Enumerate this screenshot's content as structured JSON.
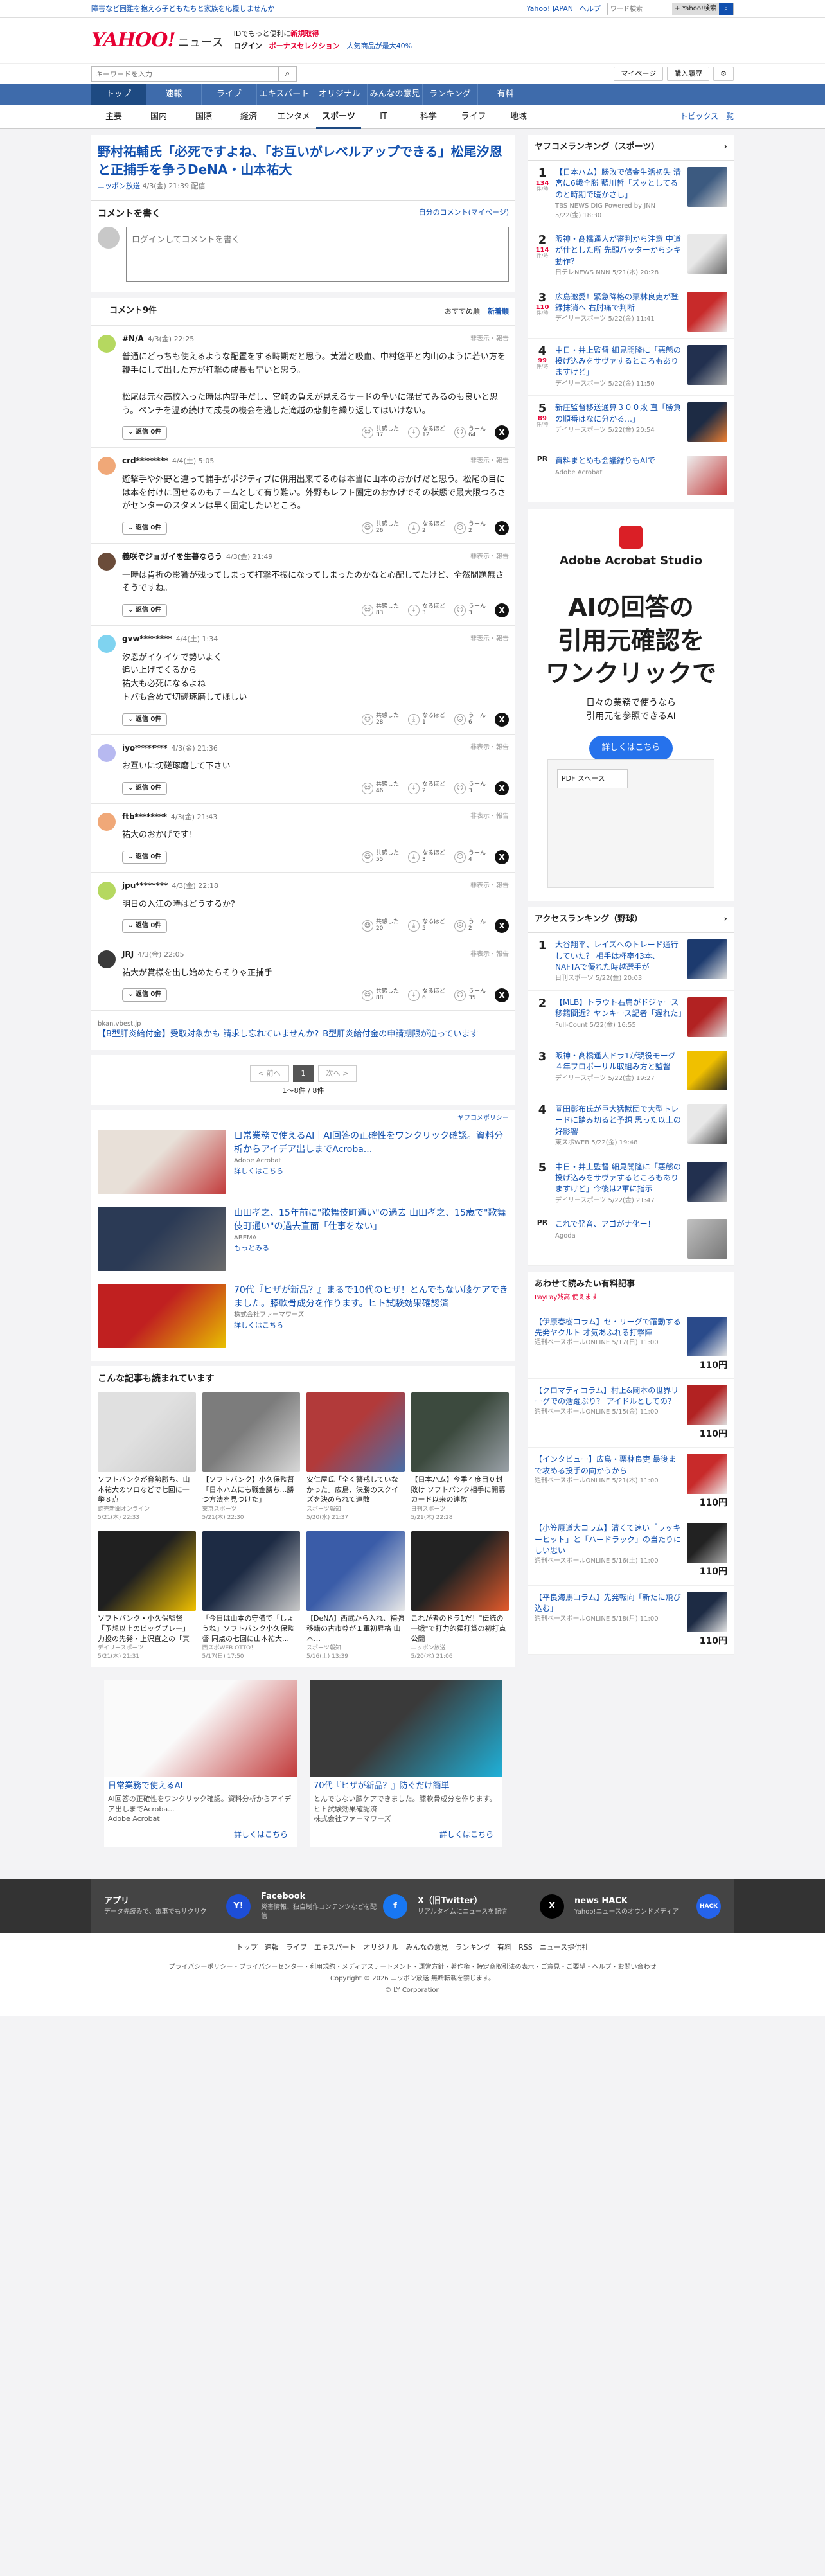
{
  "topbar": {
    "promo": "障害など困難を抱える子どもたちと家族を応援しませんか",
    "yahoo_japan": "Yahoo! JAPAN",
    "help": "ヘルプ",
    "search_placeholder": "ワード検索",
    "search_btn": "+ Yahoo!検索"
  },
  "header": {
    "logo_main": "YAHOO!",
    "logo_sub": "JAPAN",
    "logo_news": "ニュース",
    "line1": "IDでもっと便利に",
    "line1_red": "新規取得",
    "login": "ログイン",
    "bonus": "ボーナスセレクション",
    "bonus_tail": "人気商品が最大40%"
  },
  "bar2": {
    "keyword_placeholder": "キーワードを入力",
    "mypage": "マイページ",
    "history": "購入履歴"
  },
  "nav": [
    "トップ",
    "速報",
    "ライブ",
    "エキスパート",
    "オリジナル",
    "みんなの意見",
    "ランキング",
    "有料"
  ],
  "subnav": [
    "主要",
    "国内",
    "国際",
    "経済",
    "エンタメ",
    "スポーツ",
    "IT",
    "科学",
    "ライフ",
    "地域"
  ],
  "subnav_active": "スポーツ",
  "subnav_right": "トピックス一覧",
  "article": {
    "title": "野村祐輔氏「必死ですよね、「お互いがレベルアップできる」松尾汐恩と正捕手を争うDeNA・山本祐大",
    "source": "ニッポン放送",
    "date": "4/3(金) 21:39 配信"
  },
  "write": {
    "heading": "コメントを書く",
    "own": "自分のコメント(マイページ)",
    "placeholder": "ログインしてコメントを書く"
  },
  "comments_header": {
    "title": "コメント9件",
    "sort1": "おすすめ順",
    "sort2": "新着順"
  },
  "comments": [
    {
      "user": "#N/A",
      "date": "4/3(金) 22:25",
      "report": "非表示・報告",
      "text": "普通にどっちも使えるような配置をする時期だと思う。黄潜と吸血、中村悠平と内山のように若い方を鞭手にして出した方が打撃の成長も早いと思う。\n\n松尾は元々高校入った時は内野手だし、宮崎の負えが見えるサードの争いに混ぜてみるのも良いと思う。ベンチを温め続けて成長の機会を逃した滝越の悲劇を繰り返してはいけない。",
      "agree": "37",
      "understand": "12",
      "hmm": "64",
      "av": "#b5d860"
    },
    {
      "user": "crd********",
      "date": "4/4(土) 5:05",
      "report": "非表示・報告",
      "text": "遊撃手や外野と違って捕手がポジティブに併用出来てるのは本当に山本のおかげだと思う。松尾の目には本を付けに回せるのもチームとして有り難い。外野もレフト固定のおかげでその状態で最大限つろさがセンターのスタメンは早く固定したいところ。",
      "agree": "26",
      "understand": "2",
      "hmm": "2",
      "av": "#f0a878"
    },
    {
      "user": "義咲ぞジョガイを生暮ならう",
      "date": "4/3(金) 21:49",
      "report": "非表示・報告",
      "text": "一時は肯折の影響が残ってしまって打撃不振になってしまったのかなと心配してたけど、全然問題無さそうですね。",
      "agree": "83",
      "understand": "3",
      "hmm": "3",
      "av": "#6b4c3a"
    },
    {
      "user": "gvw********",
      "date": "4/4(土) 1:34",
      "report": "非表示・報告",
      "text": "汐恩がイケイケで勢いよく\n追い上げてくるから\n祐大も必死になるよね\nトバも含めて切磋琢磨してほしい",
      "agree": "28",
      "understand": "1",
      "hmm": "6",
      "av": "#7fd3f0"
    },
    {
      "user": "iyo********",
      "date": "4/3(金) 21:36",
      "report": "非表示・報告",
      "text": "お互いに切磋琢磨して下さい",
      "agree": "46",
      "understand": "2",
      "hmm": "3",
      "av": "#b7b9f0"
    },
    {
      "user": "ftb********",
      "date": "4/3(金) 21:43",
      "report": "非表示・報告",
      "text": "祐大のおかげです！",
      "agree": "55",
      "understand": "3",
      "hmm": "4",
      "av": "#f0a878"
    },
    {
      "user": "jpu********",
      "date": "4/3(金) 22:18",
      "report": "非表示・報告",
      "text": "明日の入江の時はどうするか？",
      "agree": "20",
      "understand": "5",
      "hmm": "2",
      "av": "#b5d860"
    },
    {
      "user": "JRJ",
      "date": "4/3(金) 22:05",
      "report": "非表示・報告",
      "text": "祐大が賞様を出し始めたらそりゃ正捕手",
      "agree": "88",
      "understand": "6",
      "hmm": "35",
      "av": "#3a3a3a"
    }
  ],
  "reply_label": "返信",
  "reply_count": "0件",
  "react_labels": {
    "agree": "共感した",
    "understand": "なるほど",
    "hmm": "うーん"
  },
  "inline_ad": {
    "domain": "bkan.vbest.jp",
    "title": "【B型肝炎給付金】受取対象かも 請求し忘れていませんか？B型肝炎給付金の申請期限が迫っています"
  },
  "pager": {
    "prev": "< 前へ",
    "current": "1",
    "next": "次へ >",
    "count": "1〜8件 / 8件"
  },
  "policy": "ヤフコメポリシー",
  "ads3": [
    {
      "title": "日常業務で使えるAI｜AI回答の正確性をワンクリック確認。資料分析からアイデア出しまでAcroba...",
      "sponsor": "Adobe Acrobat",
      "more": "詳しくはこちら",
      "c1": "#e8e0d8",
      "c2": "#c23b3b"
    },
    {
      "title": "山田孝之、15年前に\"歌舞伎町通い\"の過去 山田孝之、15歳で\"歌舞伎町通い\"の過去直面「仕事をない」",
      "sponsor": "ABEMA",
      "more": "もっとみる",
      "c1": "#2b3a55",
      "c2": "#6b6b6b"
    },
    {
      "title": "70代『ヒザが新品？』まるで10代のヒザ！とんでもない膝ケアできました。膝軟骨成分を作ります。ヒト試験効果確認済",
      "sponsor": "株式会社ファーマワーズ",
      "more": "詳しくはこちら",
      "c1": "#c02020",
      "c2": "#e8c000"
    }
  ],
  "recs_title": "こんな記事も読まれています",
  "recs": [
    {
      "t": "ソフトバンクが育勢勝ち、山本祐大のソロなどで七回に一挙８点",
      "s": "読売新聞オンライン",
      "d": "5/21(木) 22:33",
      "c1": "#e0e0e0",
      "c2": "#c8c8c8"
    },
    {
      "t": "【ソフトバンク】小久保監督「日本ハムにも戦金勝ち…勝つ方法を見つけた」",
      "s": "東京スポーツ",
      "d": "5/21(木) 22:30",
      "c1": "#7c7c7c",
      "c2": "#d8d8d8"
    },
    {
      "t": "安仁屋氏「全く警戒していなかった」広島、決勝のスクイズを決められて連敗",
      "s": "スポーツ報知",
      "d": "5/20(水) 21:37",
      "c1": "#b23a3a",
      "c2": "#4a6fa8"
    },
    {
      "t": "【日本ハム】今季４度目０封敗け ソフトバンク相手に開幕カード以来の連敗",
      "s": "日刊スポーツ",
      "d": "5/21(木) 22:28",
      "c1": "#3c4a3e",
      "c2": "#9aa1a8"
    },
    {
      "t": "ソフトバンク・小久保監督「予想以上のビッグプレー」力投の先発・上沢直之の「真価」と「隠れ苦労人」語る",
      "s": "デイリースポーツ",
      "d": "5/21(木) 21:31",
      "c1": "#202020",
      "c2": "#f0c000"
    },
    {
      "t": "「今日は山本の守備で「しょうね」ソフトバンク小久保監督 同点の七回に山本祐大…",
      "s": "西スポWEB OTTO！",
      "d": "5/17(日) 17:50",
      "c1": "#1d2b44",
      "c2": "#c9c9c9"
    },
    {
      "t": "【DeNA】西武から入れ、補強移籍の古市尊が１軍初昇格 山本…",
      "s": "スポーツ報知",
      "d": "5/16(土) 13:39",
      "c1": "#3a5ca8",
      "c2": "#e8e8e8"
    },
    {
      "t": "これが者のドラ1だ！\"伝統の一戦\"で打力的猛打賞の初打点 公開",
      "s": "ニッポン放送",
      "d": "5/20(水) 21:06",
      "c1": "#222",
      "c2": "#e25a2b"
    }
  ],
  "ads2": [
    {
      "title": "日常業務で使えるAI",
      "text": "AI回答の正確性をワンクリック確認。資料分析からアイデア出しまでAcroba...",
      "sponsor": "Adobe Acrobat",
      "more": "詳しくはこちら",
      "c1": "#fafafa",
      "c2": "#c23b3b"
    },
    {
      "title": "70代『ヒザが新品？』防ぐだけ簡単",
      "text": "とんでもない膝ケアできました。膝軟骨成分を作ります。ヒト試験効果確認済",
      "sponsor": "株式会社ファーマワーズ",
      "more": "詳しくはこちら",
      "c1": "#3a3a3a",
      "c2": "#1fb0d8"
    }
  ],
  "side_rank": {
    "title": "ヤフコメランキング（スポーツ）",
    "items": [
      {
        "no": "1",
        "cnt": "134",
        "lb": "件/時",
        "t": "【日本ハム】勝敗で償金生活初失 清宮に6戦全勝 藍川哲「ズッとしてるのと時期で暖かさし」",
        "s": "TBS NEWS DIG Powered by JNN",
        "d": "5/22(金) 18:30",
        "c1": "#3c5a80",
        "c2": "#d0d0d0"
      },
      {
        "no": "2",
        "cnt": "114",
        "lb": "件/時",
        "t": "阪神・髙橋遥人が審判から注意 中道が仕とした所 先頭バッターからシキ動作？",
        "s": "日テレNEWS NNN",
        "d": "5/21(木) 20:28",
        "c1": "#e8e8e8",
        "c2": "#666"
      },
      {
        "no": "3",
        "cnt": "110",
        "lb": "件/時",
        "t": "広島邀愛！緊急降格の栗林良吏が登録抹消へ 右肘痛で判断",
        "s": "デイリースポーツ",
        "d": "5/22(金) 11:41",
        "c1": "#c82a2a",
        "c2": "#e8e8e8"
      },
      {
        "no": "4",
        "cnt": "99",
        "lb": "件/時",
        "t": "中日・井上監督 細見開隆に「悪態の投げ込みをサヴァするところもありますけど」",
        "s": "デイリースポーツ",
        "d": "5/22(金) 11:50",
        "c1": "#22304f",
        "c2": "#aaa"
      },
      {
        "no": "5",
        "cnt": "89",
        "lb": "件/時",
        "t": "新庄監督移送通算３００敗 直「勝負の順番はなに分かる…」",
        "s": "デイリースポーツ",
        "d": "5/22(金) 20:54",
        "c1": "#1d2b44",
        "c2": "#f08030"
      }
    ],
    "pr_title": "資料まとめも会議録りもAIで",
    "pr_src": "Adobe Acrobat"
  },
  "bigad": {
    "brand": "Adobe Acrobat Studio",
    "h1": "AIの回答の\n引用元確認を\nワンクリックで",
    "sub": "日々の業務で使うなら\n引用元を参照できるAI",
    "btn": "詳しくはこちら",
    "pdf": "PDF スペース"
  },
  "access": {
    "title": "アクセスランキング（野球）",
    "items": [
      {
        "no": "1",
        "t": "大谷翔平、レイズへのトレード通行していた？ 相手は杯率43本、NAFTAで優れた時越選手が",
        "s": "日刊スポーツ",
        "d": "5/22(金) 20:03",
        "c1": "#1c3a6e",
        "c2": "#e0e0e0"
      },
      {
        "no": "2",
        "t": "【MLB】トラウト右肩がドジャース移籍間近？ヤンキース記者「遅れた」",
        "s": "Full-Count",
        "d": "5/22(金) 16:55",
        "c1": "#b22222",
        "c2": "#ddd"
      },
      {
        "no": "3",
        "t": "阪神・髙橋遥人ドラ1が現役モーグ ４年プロポーサル取組み方と監督",
        "s": "デイリースポーツ",
        "d": "5/22(金) 19:27",
        "c1": "#f0c000",
        "c2": "#222"
      },
      {
        "no": "4",
        "t": "岡田彰布氏が巨大猛獣団で大型トレードに踏み切ると予想 思った以上の好影響",
        "s": "東スポWEB",
        "d": "5/22(金) 19:48",
        "c1": "#e8e8e8",
        "c2": "#444"
      },
      {
        "no": "5",
        "t": "中日・井上監督 細見開隆に「悪態の投げ込みをサヴァするところもありますけど」今後は2軍に指示",
        "s": "デイリースポーツ",
        "d": "5/22(金) 21:47",
        "c1": "#22304f",
        "c2": "#bbb"
      }
    ],
    "pr_title": "これで発音、アゴがナ化ー！",
    "pr_src": "Agoda"
  },
  "paid": {
    "title": "あわせて読みたい有料記事",
    "badge": "PayPay残高 使えます",
    "items": [
      {
        "t": "【伊原春樹コラム】セ・リーグで躍動する先発ヤクルト 才気あふれる打撃陣",
        "s": "週刊ベースボールONLINE",
        "d": "5/17(日) 11:00",
        "p": "110円",
        "c1": "#2a4a8a",
        "c2": "#e8e8e8"
      },
      {
        "t": "【クロマティコラム】村上&岡本の世界リーグでの活躍ぶり？ アイドルとしての？",
        "s": "週刊ベースボールONLINE",
        "d": "5/15(金) 11:00",
        "p": "110円",
        "c1": "#b22222",
        "c2": "#ddd"
      },
      {
        "t": "【インタビュー】広島・栗林良吏 最後まで攻める投手の向かうから",
        "s": "週刊ベースボールONLINE",
        "d": "5/21(木) 11:00",
        "p": "110円",
        "c1": "#c82a2a",
        "c2": "#eee"
      },
      {
        "t": "【小笠原道大コラム】清くて速い「ラッキーヒット」と「ハードラック」の当たりにしい思い",
        "s": "週刊ベースボールONLINE",
        "d": "5/16(土) 11:00",
        "p": "110円",
        "c1": "#222",
        "c2": "#aaa"
      },
      {
        "t": "【平良海馬コラム】先発転向「新たに飛び込む」",
        "s": "週刊ベースボールONLINE",
        "d": "5/18(月) 11:00",
        "p": "110円",
        "c1": "#1d2b44",
        "c2": "#e8e8e8"
      }
    ]
  },
  "footer": {
    "cols": [
      {
        "t": "アプリ",
        "d": "データ先読みで、電車でもサクサク",
        "icon": "Y!",
        "color": "#1d4ed8"
      },
      {
        "t": "Facebook",
        "d": "災害情報、独自制作コンテンツなどを配信",
        "icon": "f",
        "color": "#1877f2"
      },
      {
        "t": "X（旧Twitter）",
        "d": "リアルタイムにニュースを配信",
        "icon": "X",
        "color": "#000"
      },
      {
        "t": "news HACK",
        "d": "Yahoo!ニュースのオウンドメディア",
        "icon": "HACK",
        "color": "#2563eb"
      }
    ],
    "links": "トップ　速報　ライブ　エキスパート　オリジナル　みんなの意見　ランキング　有料　RSS　ニュース提供社",
    "legal1": "プライバシーポリシー・プライバシーセンター・利用規約・メディアステートメント・運営方針・著作権・特定商取引法の表示・ご意見・ご要望・ヘルプ・お問い合わせ",
    "legal2": "Copyright © 2026 ニッポン放送 無断転載を禁じます。",
    "legal3": "© LY Corporation"
  }
}
